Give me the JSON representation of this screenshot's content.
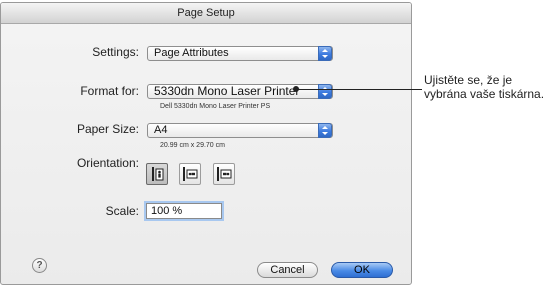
{
  "dialog": {
    "title": "Page Setup",
    "settings": {
      "label": "Settings:",
      "value": "Page Attributes"
    },
    "format_for": {
      "label": "Format for:",
      "value": "5330dn Mono Laser Printer",
      "subtitle": "Dell 5330dn Mono Laser Printer PS"
    },
    "paper_size": {
      "label": "Paper Size:",
      "value": "A4",
      "dimensions": "20.99 cm x 29.70 cm"
    },
    "orientation": {
      "label": "Orientation:",
      "options": [
        "portrait",
        "landscape-left",
        "landscape-right"
      ],
      "selected": "portrait"
    },
    "scale": {
      "label": "Scale:",
      "value": "100 %"
    },
    "buttons": {
      "help": "?",
      "cancel": "Cancel",
      "ok": "OK"
    }
  },
  "annotation": {
    "text": "Ujistěte se, že je vybrána vaše tiskárna."
  },
  "colors": {
    "accent_blue": "#3c7be0",
    "focus_ring": "#a8c8f0",
    "dialog_bg": "#ebebeb"
  }
}
